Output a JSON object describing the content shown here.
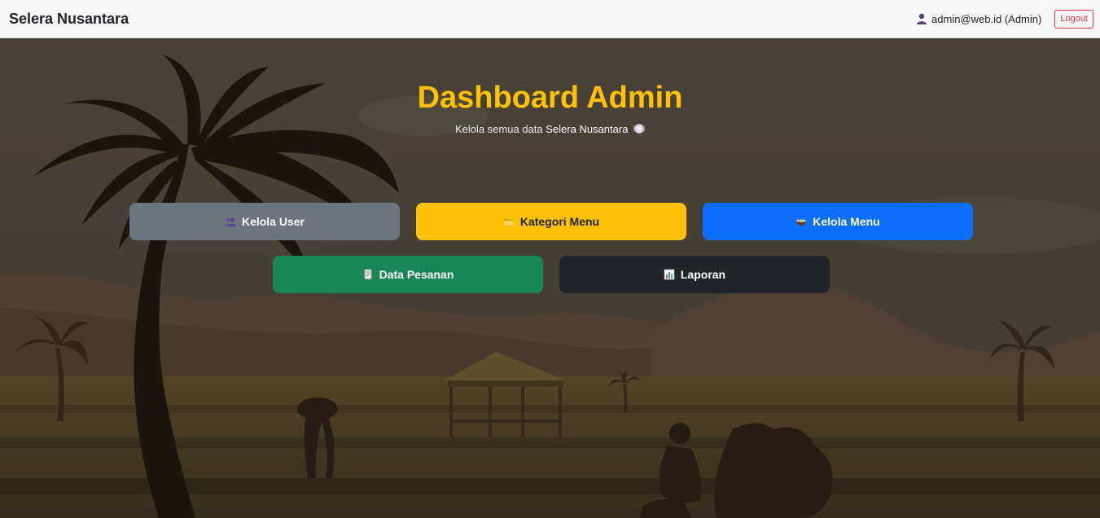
{
  "navbar": {
    "brand": "Selera Nusantara",
    "user_text": "admin@web.id (Admin)",
    "user_icon": "user-icon",
    "logout_label": "Logout"
  },
  "header": {
    "title": "Dashboard Admin",
    "subtitle_prefix": "Kelola semua data",
    "subtitle_brand": "Selera Nusantara",
    "subtitle_icon": "plate-icon"
  },
  "actions": {
    "kelola_user": "Kelola User",
    "kategori_menu": "Kategori Menu",
    "kelola_menu": "Kelola Menu",
    "data_pesanan": "Data Pesanan",
    "laporan": "Laporan"
  },
  "colors": {
    "title": "#ffc107",
    "kelola_user": "#6c757d",
    "kategori_menu": "#ffc107",
    "kelola_menu": "#0d6efd",
    "data_pesanan": "#198754",
    "laporan": "#212529",
    "logout": "#dc3545"
  }
}
